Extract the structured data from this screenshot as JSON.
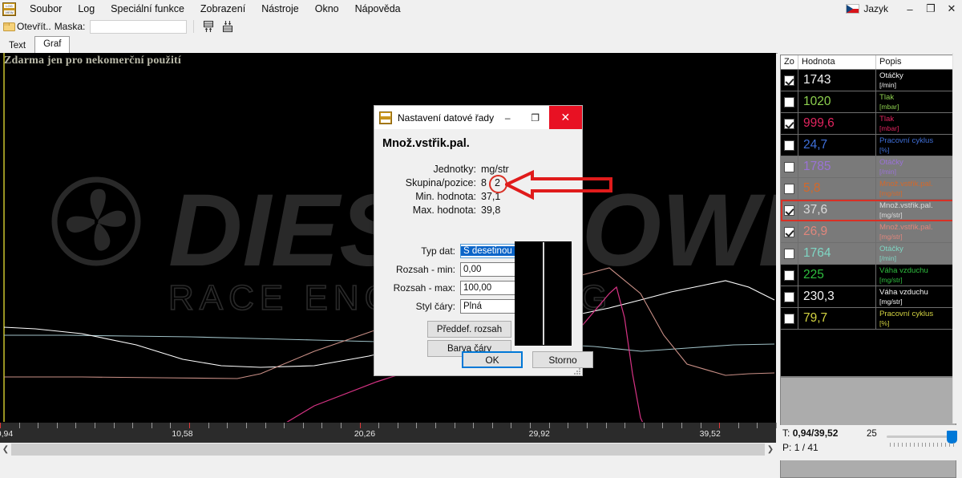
{
  "window": {
    "language_label": "Jazyk",
    "minimize": "–",
    "maximize": "❐",
    "close": "✕"
  },
  "menu": {
    "items": [
      "Soubor",
      "Log",
      "Speciální funkce",
      "Zobrazení",
      "Nástroje",
      "Okno",
      "Nápověda"
    ]
  },
  "toolbar": {
    "open_label": "Otevřít..",
    "mask_label": "Maska:",
    "mask_value": ""
  },
  "tabs": [
    {
      "label": "Text",
      "active": false
    },
    {
      "label": "Graf",
      "active": true
    }
  ],
  "chart_overlay": {
    "free_text": "Zdarma jen pro nekomerční použití",
    "watermark_main": "DIESEL POWER",
    "watermark_sub": "RACE ENGINEERING"
  },
  "chart_data": {
    "type": "line",
    "title": "",
    "xlabel": "",
    "ylabel": "",
    "grid": false,
    "legend": "right-panel",
    "xlim": [
      0.94,
      39.52
    ],
    "axis_tick_labels": [
      "0,94",
      "10,58",
      "20,26",
      "29,92",
      "39,52"
    ],
    "axis_tick_positions_pct": [
      0.5,
      23.5,
      47.0,
      69.5,
      91.5
    ],
    "minor_ticks_count": 41,
    "series": [
      {
        "name": "Otáčky [/min]",
        "color": "#ffffff",
        "points": [
          [
            0,
            342
          ],
          [
            4,
            344
          ],
          [
            10,
            350
          ],
          [
            17,
            364
          ],
          [
            23,
            382
          ],
          [
            28,
            390
          ],
          [
            33,
            392
          ],
          [
            40,
            390
          ],
          [
            47,
            378
          ],
          [
            54,
            362
          ],
          [
            60,
            350
          ],
          [
            66,
            340
          ],
          [
            72,
            330
          ],
          [
            78,
            318
          ],
          [
            82,
            308
          ],
          [
            86,
            298
          ],
          [
            90,
            290
          ],
          [
            93,
            284
          ],
          [
            96,
            292
          ],
          [
            100,
            308
          ]
        ]
      },
      {
        "name": "Tlak [mbar] (pink)",
        "color": "#d63384",
        "points": [
          [
            0,
            505
          ],
          [
            8,
            507
          ],
          [
            17,
            509
          ],
          [
            24,
            510
          ],
          [
            28,
            505
          ],
          [
            33,
            480
          ],
          [
            40,
            440
          ],
          [
            48,
            410
          ],
          [
            55,
            388
          ],
          [
            62,
            372
          ],
          [
            68,
            358
          ],
          [
            74,
            345
          ],
          [
            78,
            300
          ],
          [
            79,
            292
          ],
          [
            80,
            330
          ],
          [
            81,
            400
          ],
          [
            82,
            455
          ],
          [
            84,
            495
          ],
          [
            86,
            510
          ],
          [
            88,
            505
          ],
          [
            92,
            488
          ],
          [
            96,
            478
          ],
          [
            100,
            476
          ]
        ]
      },
      {
        "name": "Množ.vstřik.pal. [mg/str]",
        "color": "#c98f86",
        "points": [
          [
            0,
            404
          ],
          [
            10,
            404
          ],
          [
            20,
            405
          ],
          [
            30,
            406
          ],
          [
            33,
            400
          ],
          [
            40,
            372
          ],
          [
            48,
            345
          ],
          [
            55,
            325
          ],
          [
            62,
            307
          ],
          [
            68,
            292
          ],
          [
            74,
            278
          ],
          [
            78,
            268
          ],
          [
            82,
            300
          ],
          [
            85,
            352
          ],
          [
            88,
            388
          ],
          [
            92,
            402
          ],
          [
            96,
            400
          ],
          [
            100,
            399
          ]
        ]
      },
      {
        "name": "Pracovní cyklus [%] (blue-grey)",
        "color": "#9fc0c6",
        "points": [
          [
            0,
            352
          ],
          [
            8,
            352
          ],
          [
            16,
            353
          ],
          [
            24,
            354
          ],
          [
            32,
            356
          ],
          [
            40,
            358
          ],
          [
            48,
            360
          ],
          [
            56,
            361
          ],
          [
            64,
            362
          ],
          [
            70,
            363
          ],
          [
            76,
            366
          ],
          [
            82,
            372
          ],
          [
            88,
            368
          ],
          [
            94,
            364
          ],
          [
            100,
            363
          ]
        ]
      }
    ]
  },
  "data_grid": {
    "columns": [
      "Zo",
      "Hodnota",
      "Popis"
    ],
    "rows": [
      {
        "checked": true,
        "value": "1743",
        "name": "Otáčky",
        "unit": "[/min]",
        "color": "#f2f2f2",
        "disabled": false,
        "selected": false
      },
      {
        "checked": false,
        "value": "1020",
        "name": "Tlak",
        "unit": "[mbar]",
        "color": "#8ed14f",
        "disabled": false,
        "selected": false
      },
      {
        "checked": true,
        "value": "999,6",
        "name": "Tlak",
        "unit": "[mbar]",
        "color": "#e0245e",
        "disabled": false,
        "selected": false
      },
      {
        "checked": false,
        "value": "24,7",
        "name": "Pracovní cyklus",
        "unit": "[%]",
        "color": "#3f6fd8",
        "disabled": false,
        "selected": false
      },
      {
        "checked": false,
        "value": "1785",
        "name": "Otáčky",
        "unit": "[/min]",
        "color": "#9a72d6",
        "disabled": true,
        "selected": false
      },
      {
        "checked": false,
        "value": "5,8",
        "name": "Množ.vstřik.pal.",
        "unit": "[mg/str]",
        "color": "#d4682a",
        "disabled": true,
        "selected": false
      },
      {
        "checked": true,
        "value": "37,6",
        "name": "Množ.vstřik.pal.",
        "unit": "[mg/str]",
        "color": "#dcdcdc",
        "disabled": true,
        "selected": true
      },
      {
        "checked": true,
        "value": "26,9",
        "name": "Množ.vstřik.pal.",
        "unit": "[mg/str]",
        "color": "#e0867c",
        "disabled": true,
        "selected": false
      },
      {
        "checked": false,
        "value": "1764",
        "name": "Otáčky",
        "unit": "[/min]",
        "color": "#7fd6c4",
        "disabled": true,
        "selected": false
      },
      {
        "checked": false,
        "value": "225",
        "name": "Váha vzduchu",
        "unit": "[mg/str]",
        "color": "#2fbf3f",
        "disabled": false,
        "selected": false
      },
      {
        "checked": false,
        "value": "230,3",
        "name": "Váha vzduchu",
        "unit": "[mg/str]",
        "color": "#f5f5f5",
        "disabled": false,
        "selected": false
      },
      {
        "checked": false,
        "value": "79,7",
        "name": "Pracovní cyklus",
        "unit": "[%]",
        "color": "#d3d341",
        "disabled": false,
        "selected": false
      }
    ]
  },
  "status": {
    "time_label": "T:",
    "time_value": "0,94/39,52",
    "page_label": "P:",
    "page_value": "1 / 41",
    "slider_value": "25"
  },
  "dialog": {
    "title": "Nastavení datové řady",
    "heading": "Množ.vstřik.pal.",
    "info": [
      {
        "label": "Jednotky:",
        "value": "mg/str"
      },
      {
        "label": "Skupina/pozice:",
        "value": "8",
        "value2": "2",
        "circled": true
      },
      {
        "label": "Min. hodnota:",
        "value": "37,1"
      },
      {
        "label": "Max. hodnota:",
        "value": "39,8"
      }
    ],
    "fields": {
      "datatype_label": "Typ dat:",
      "datatype_value": "S desetinou čárkou",
      "range_min_label": "Rozsah - min:",
      "range_min_value": "0,00",
      "range_max_label": "Rozsah - max:",
      "range_max_value": "100,00",
      "linestyle_label": "Styl čáry:",
      "linestyle_value": "Plná"
    },
    "buttons": {
      "predef_range": "Předdef. rozsah",
      "line_color": "Barva čáry",
      "ok": "OK",
      "cancel": "Storno"
    },
    "minimize": "–",
    "maximize": "❐",
    "close": "✕"
  }
}
